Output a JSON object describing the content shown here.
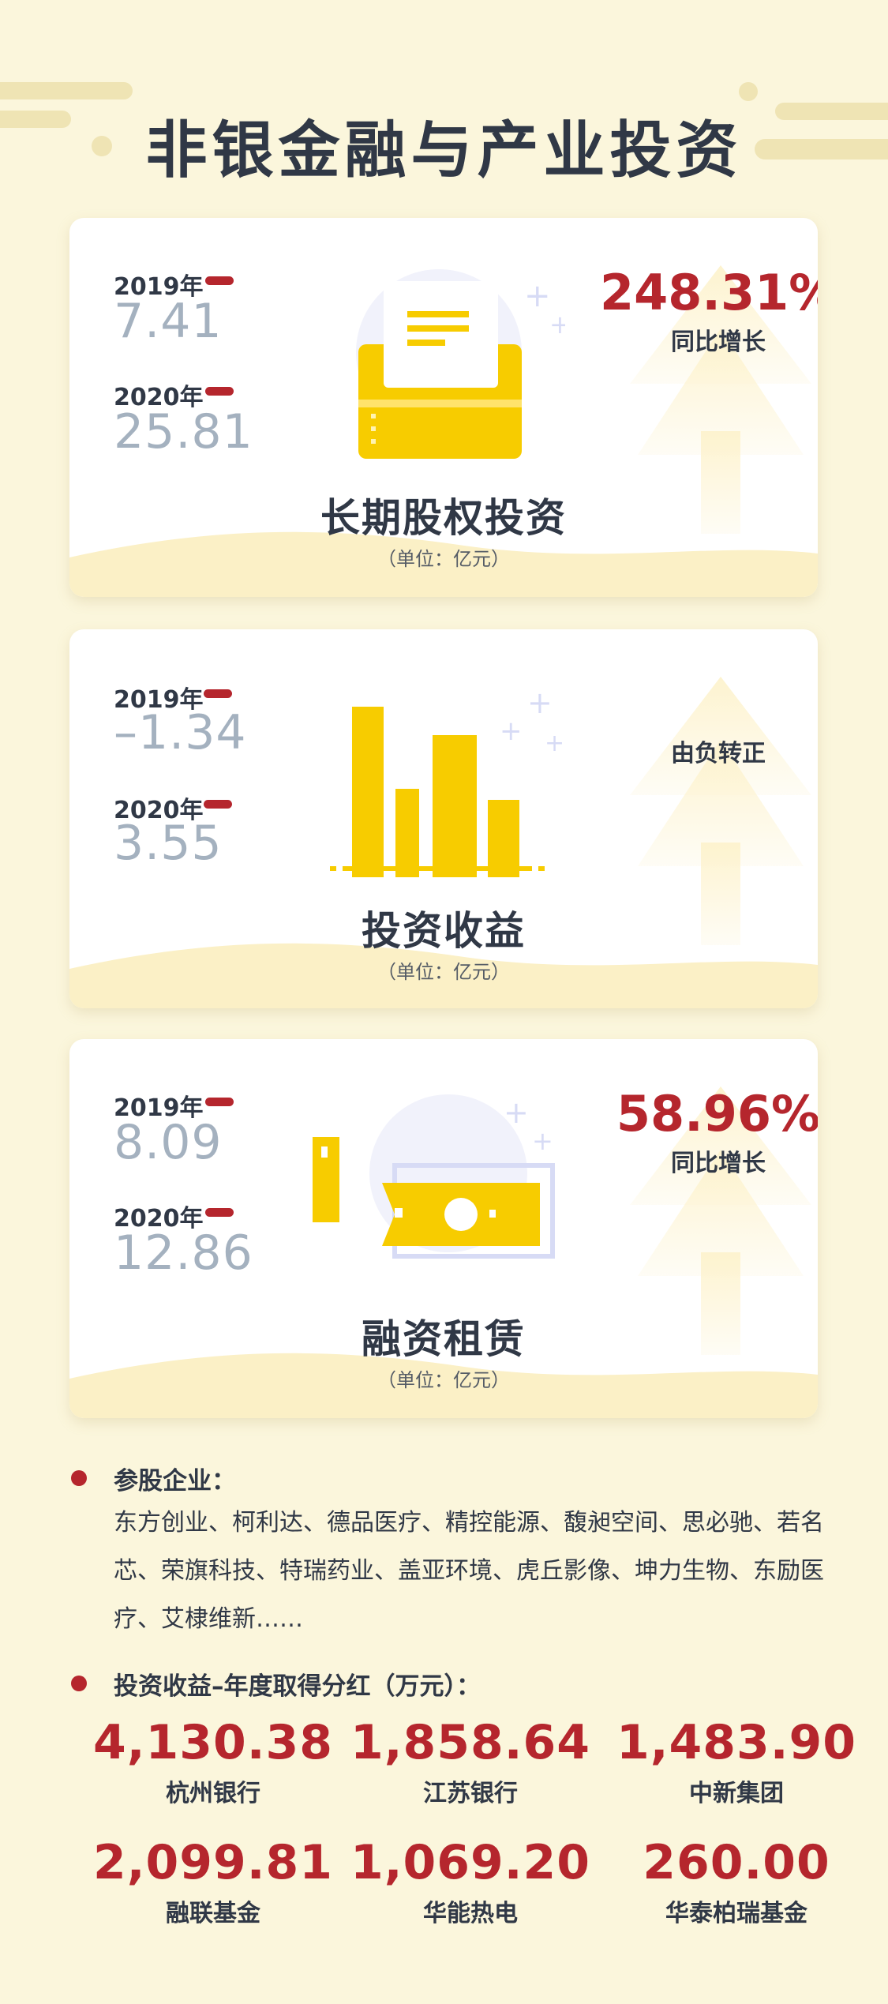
{
  "page": {
    "title": "非银金融与产业投资"
  },
  "colors": {
    "background": "#fbf6dc",
    "accent_red": "#b5262d",
    "illustration_yellow": "#f7cc00",
    "value_gray": "#a4b1bf",
    "text_dark": "#303846"
  },
  "cards": [
    {
      "icon": "inbox-tray-icon",
      "year_2019_label": "2019年",
      "year_2019_value": "7.41",
      "year_2020_label": "2020年",
      "year_2020_value": "25.81",
      "growth_pct": "248.31%",
      "growth_label": "同比增长",
      "title": "长期股权投资",
      "unit": "（单位：亿元）"
    },
    {
      "icon": "bar-chart-icon",
      "year_2019_label": "2019年",
      "year_2019_value": "–1.34",
      "year_2020_label": "2020年",
      "year_2020_value": "3.55",
      "growth_pct": "",
      "growth_label": "由负转正",
      "title": "投资收益",
      "unit": "（单位：亿元）"
    },
    {
      "icon": "cash-bill-icon",
      "year_2019_label": "2019年",
      "year_2019_value": "8.09",
      "year_2020_label": "2020年",
      "year_2020_value": "12.86",
      "growth_pct": "58.96%",
      "growth_label": "同比增长",
      "title": "融资租赁",
      "unit": "（单位：亿元）"
    }
  ],
  "partners": {
    "heading": "参股企业：",
    "text": "东方创业、柯利达、德品医疗、精控能源、馥昶空间、思必驰、若名芯、荣旗科技、特瑞药业、盖亚环境、虎丘影像、坤力生物、东励医疗、艾棣维新……"
  },
  "dividends": {
    "heading": "投资收益–年度取得分红（万元）：",
    "items": [
      {
        "value": "4,130.38",
        "name": "杭州银行"
      },
      {
        "value": "1,858.64",
        "name": "江苏银行"
      },
      {
        "value": "1,483.90",
        "name": "中新集团"
      },
      {
        "value": "2,099.81",
        "name": "融联基金"
      },
      {
        "value": "1,069.20",
        "name": "华能热电"
      },
      {
        "value": "260.00",
        "name": "华泰柏瑞基金"
      }
    ]
  }
}
